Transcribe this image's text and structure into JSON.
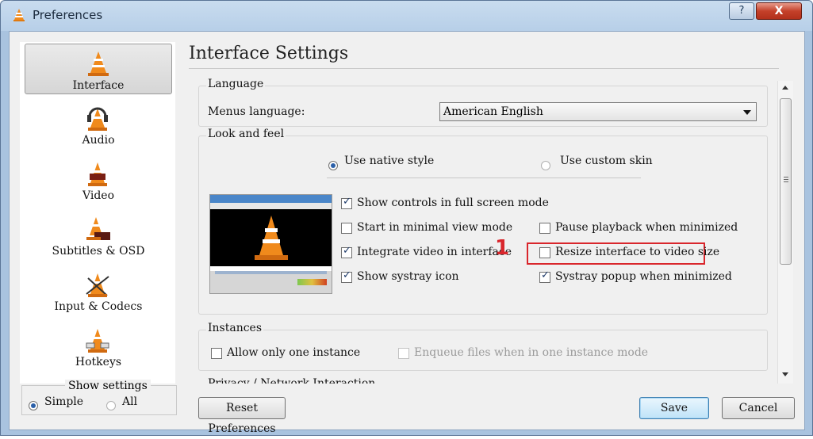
{
  "window": {
    "title": "Preferences",
    "help_label": "?",
    "close_label": "X"
  },
  "sidebar": {
    "items": [
      {
        "label": "Interface",
        "icon": "vlc-cone-icon"
      },
      {
        "label": "Audio",
        "icon": "headphones-cone-icon"
      },
      {
        "label": "Video",
        "icon": "video-cone-icon"
      },
      {
        "label": "Subtitles & OSD",
        "icon": "subtitles-cone-icon"
      },
      {
        "label": "Input & Codecs",
        "icon": "input-cone-icon"
      },
      {
        "label": "Hotkeys",
        "icon": "hotkeys-cone-icon"
      }
    ],
    "show_settings": {
      "legend": "Show settings",
      "simple": "Simple",
      "all": "All",
      "selected": "Simple"
    }
  },
  "main": {
    "title": "Interface Settings",
    "language": {
      "group": "Language",
      "menus_label": "Menus language:",
      "menus_value": "American English"
    },
    "look_and_feel": {
      "group": "Look and feel",
      "native_style": "Use native style",
      "custom_skin": "Use custom skin",
      "show_controls_fullscreen": "Show controls in full screen mode",
      "minimal_view": "Start in minimal view mode",
      "integrate_video": "Integrate video in interface",
      "systray_icon": "Show systray icon",
      "pause_minimized": "Pause playback when minimized",
      "resize_interface": "Resize interface to video size",
      "systray_popup": "Systray popup when minimized",
      "marker": "1"
    },
    "instances": {
      "group": "Instances",
      "only_one": "Allow only one instance",
      "enqueue": "Enqueue files when in one instance mode"
    },
    "next_group": "Privacy / Network Interaction"
  },
  "buttons": {
    "reset": "Reset Preferences",
    "save": "Save",
    "cancel": "Cancel"
  },
  "colors": {
    "highlight": "#d9262c",
    "accent": "#2a5fa8"
  }
}
